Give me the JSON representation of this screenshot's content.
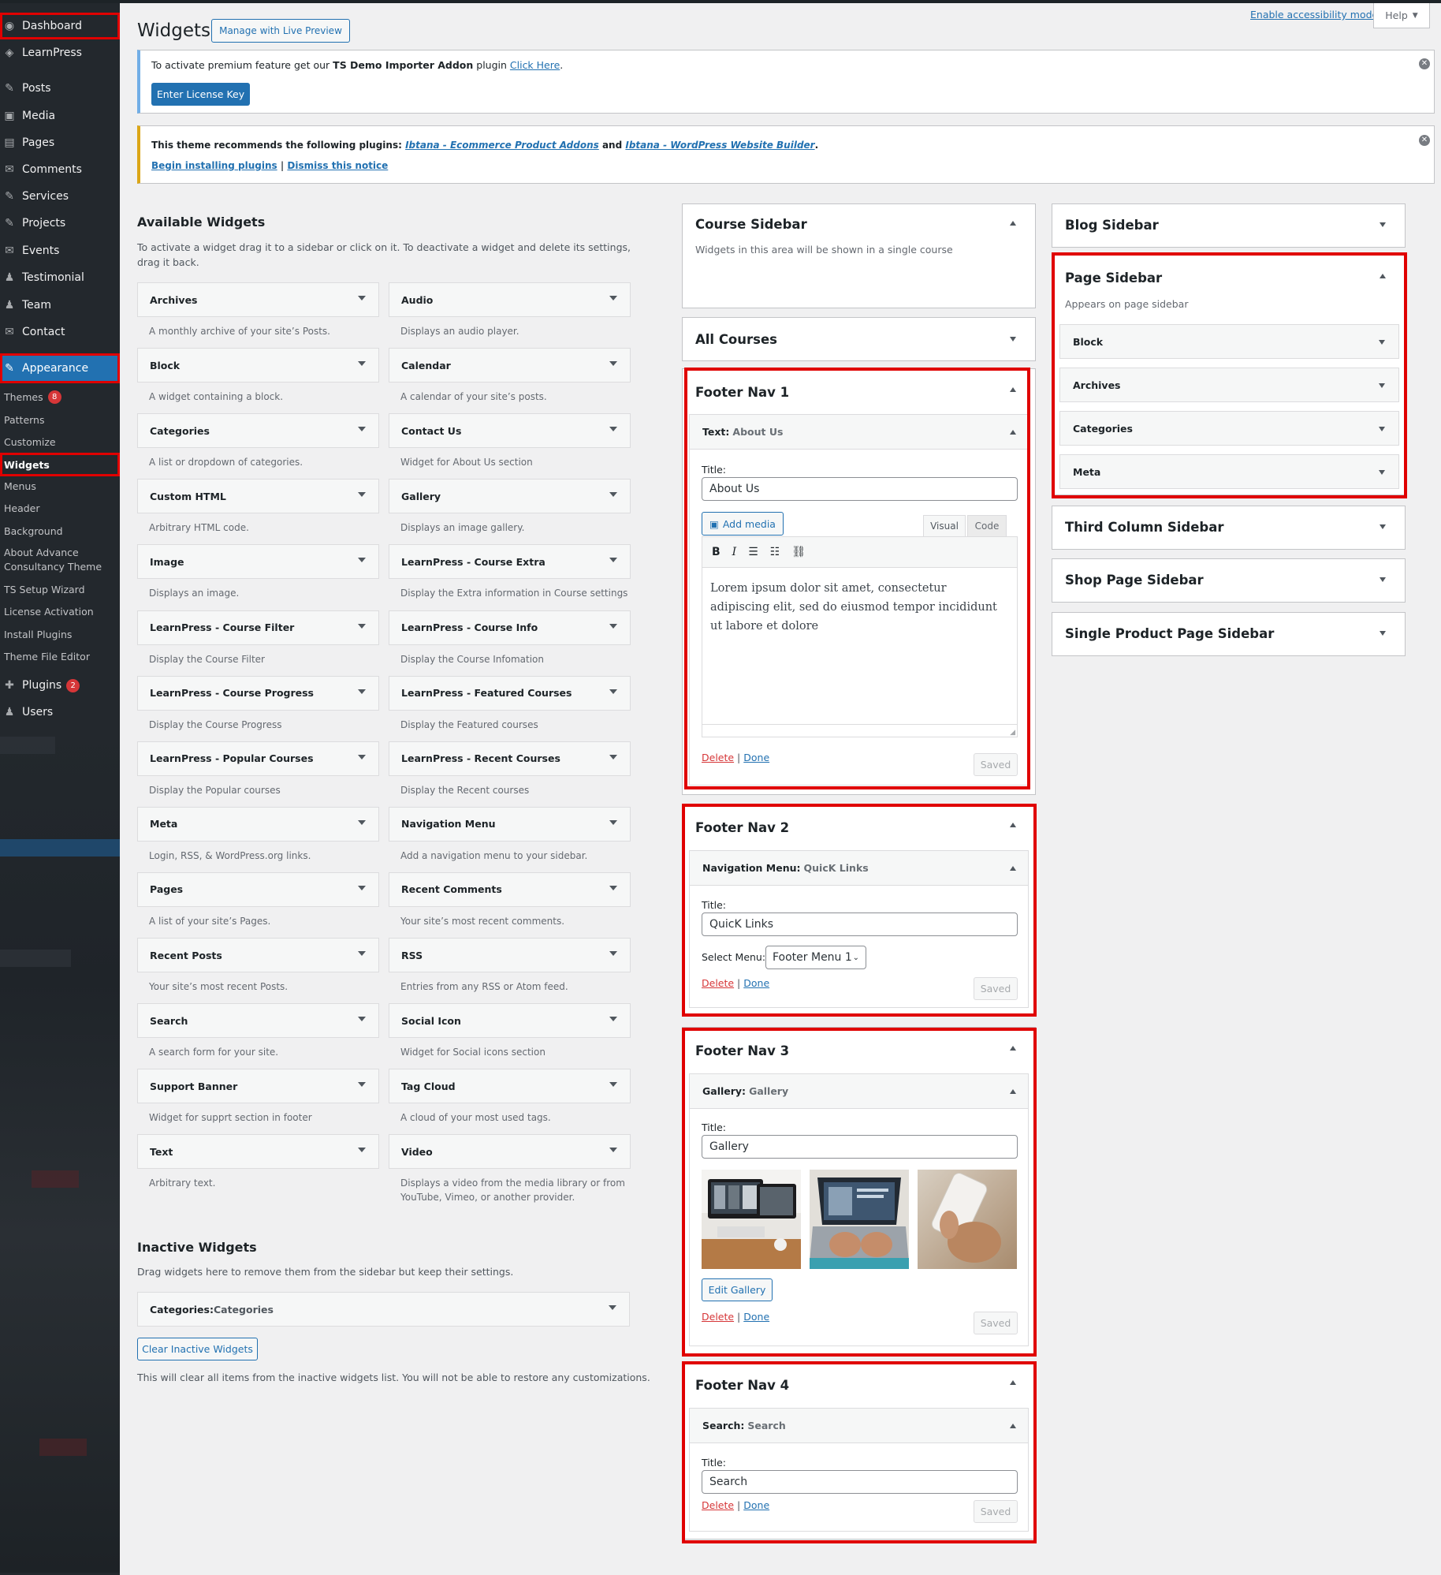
{
  "nav": {
    "items": [
      {
        "label": "Dashboard",
        "icon": "dashboard-icon",
        "glyph": "◉"
      },
      {
        "label": "LearnPress",
        "icon": "learnpress-icon",
        "glyph": "◈"
      },
      {
        "label": "Posts",
        "icon": "pin-icon",
        "glyph": "✎"
      },
      {
        "label": "Media",
        "icon": "media-icon",
        "glyph": "▣"
      },
      {
        "label": "Pages",
        "icon": "pages-icon",
        "glyph": "▤"
      },
      {
        "label": "Comments",
        "icon": "comments-icon",
        "glyph": "✉"
      },
      {
        "label": "Services",
        "icon": "services-icon",
        "glyph": "✎"
      },
      {
        "label": "Projects",
        "icon": "projects-icon",
        "glyph": "✎"
      },
      {
        "label": "Events",
        "icon": "events-icon",
        "glyph": "✉"
      },
      {
        "label": "Testimonial",
        "icon": "testimonial-icon",
        "glyph": "♟"
      },
      {
        "label": "Team",
        "icon": "team-icon",
        "glyph": "♟"
      },
      {
        "label": "Contact",
        "icon": "contact-icon",
        "glyph": "✉"
      },
      {
        "label": "Appearance",
        "icon": "appearance-icon",
        "glyph": "✎"
      },
      {
        "label": "Plugins",
        "icon": "plugins-icon",
        "glyph": "✚"
      },
      {
        "label": "Users",
        "icon": "users-icon",
        "glyph": "♟"
      }
    ],
    "appearance_sub": [
      "Themes",
      "Patterns",
      "Customize",
      "Widgets",
      "Menus",
      "Header",
      "Background",
      "About Advance Consultancy Theme",
      "TS Setup Wizard",
      "License Activation",
      "Install Plugins",
      "Theme File Editor"
    ],
    "themes_badge": "8",
    "plugins_badge": "2"
  },
  "header": {
    "title": "Widgets",
    "live_preview": "Manage with Live Preview",
    "accessibility": "Enable accessibility mode",
    "help": "Help"
  },
  "notice1": {
    "text_a": "To activate premium feature get our ",
    "text_b": "TS Demo Importer Addon",
    "text_c": " plugin ",
    "link": "Click Here",
    "text_d": ".",
    "button": "Enter License Key"
  },
  "notice2": {
    "text_a": "This theme recommends the following plugins: ",
    "plugin1": "Ibtana - Ecommerce Product Addons",
    "and": " and ",
    "plugin2": "Ibtana - WordPress Website Builder",
    "end": ".",
    "begin": "Begin installing plugins",
    "sep": " | ",
    "dismiss": "Dismiss this notice"
  },
  "available": {
    "title": "Available Widgets",
    "desc": "To activate a widget drag it to a sidebar or click on it. To deactivate a widget and delete its settings, drag it back.",
    "widgets": [
      {
        "name": "Archives",
        "desc": "A monthly archive of your site’s Posts."
      },
      {
        "name": "Audio",
        "desc": "Displays an audio player."
      },
      {
        "name": "Block",
        "desc": "A widget containing a block."
      },
      {
        "name": "Calendar",
        "desc": "A calendar of your site’s posts."
      },
      {
        "name": "Categories",
        "desc": "A list or dropdown of categories."
      },
      {
        "name": "Contact Us",
        "desc": "Widget for About Us section"
      },
      {
        "name": "Custom HTML",
        "desc": "Arbitrary HTML code."
      },
      {
        "name": "Gallery",
        "desc": "Displays an image gallery."
      },
      {
        "name": "Image",
        "desc": "Displays an image."
      },
      {
        "name": "LearnPress - Course Extra",
        "desc": "Display the Extra information in Course settings"
      },
      {
        "name": "LearnPress - Course Filter",
        "desc": "Display the Course Filter"
      },
      {
        "name": "LearnPress - Course Info",
        "desc": "Display the Course Infomation"
      },
      {
        "name": "LearnPress - Course Progress",
        "desc": "Display the Course Progress"
      },
      {
        "name": "LearnPress - Featured Courses",
        "desc": "Display the Featured courses"
      },
      {
        "name": "LearnPress - Popular Courses",
        "desc": "Display the Popular courses"
      },
      {
        "name": "LearnPress - Recent Courses",
        "desc": "Display the Recent courses"
      },
      {
        "name": "Meta",
        "desc": "Login, RSS, & WordPress.org links."
      },
      {
        "name": "Navigation Menu",
        "desc": "Add a navigation menu to your sidebar."
      },
      {
        "name": "Pages",
        "desc": "A list of your site’s Pages."
      },
      {
        "name": "Recent Comments",
        "desc": "Your site’s most recent comments."
      },
      {
        "name": "Recent Posts",
        "desc": "Your site’s most recent Posts."
      },
      {
        "name": "RSS",
        "desc": "Entries from any RSS or Atom feed."
      },
      {
        "name": "Search",
        "desc": "A search form for your site."
      },
      {
        "name": "Social Icon",
        "desc": "Widget for Social icons section"
      },
      {
        "name": "Support Banner",
        "desc": "Widget for supprt section in footer"
      },
      {
        "name": "Tag Cloud",
        "desc": "A cloud of your most used tags."
      },
      {
        "name": "Text",
        "desc": "Arbitrary text."
      },
      {
        "name": "Video",
        "desc": "Displays a video from the media library or from YouTube, Vimeo, or another provider."
      }
    ]
  },
  "inactive": {
    "title": "Inactive Widgets",
    "desc": "Drag widgets here to remove them from the sidebar but keep their settings.",
    "widget_type": "Categories:",
    "widget_title": " Categories",
    "clear": "Clear Inactive Widgets",
    "note": "This will clear all items from the inactive widgets list. You will not be able to restore any customizations."
  },
  "course_sidebar": {
    "title": "Course Sidebar",
    "desc": "Widgets in this area will be shown in a single course"
  },
  "all_courses": {
    "title": "All Courses"
  },
  "footer1": {
    "title": "Footer Nav 1",
    "widget_type": "Text:",
    "widget_title": "About Us",
    "title_label": "Title:",
    "title_value": "About Us",
    "add_media": "Add media",
    "tab_visual": "Visual",
    "tab_code": "Code",
    "content": "Lorem ipsum dolor sit amet, consectetur adipiscing elit, sed do eiusmod tempor incididunt ut labore et dolore"
  },
  "footer2": {
    "title": "Footer Nav 2",
    "widget_type": "Navigation Menu:",
    "widget_title": "QuicK Links",
    "title_label": "Title:",
    "title_value": "QuicK Links",
    "select_label": "Select Menu:",
    "select_value": "Footer Menu 1"
  },
  "footer3": {
    "title": "Footer Nav 3",
    "widget_type": "Gallery:",
    "widget_title": "Gallery",
    "title_label": "Title:",
    "title_value": "Gallery",
    "edit": "Edit Gallery"
  },
  "footer4": {
    "title": "Footer Nav 4",
    "widget_type": "Search:",
    "widget_title": "Search",
    "title_label": "Title:",
    "title_value": "Search"
  },
  "common": {
    "delete": "Delete",
    "sep": " | ",
    "done": "Done",
    "saved": "Saved"
  },
  "right": {
    "blog": "Blog Sidebar",
    "page": "Page Sidebar",
    "page_desc": "Appears on page sidebar",
    "page_widgets": [
      "Block",
      "Archives",
      "Categories",
      "Meta"
    ],
    "third": "Third Column Sidebar",
    "shop": "Shop Page Sidebar",
    "single": "Single Product Page Sidebar"
  },
  "colors": {
    "accent": "#2271b1",
    "highlight": "#e00000",
    "sidebar_bg": "#23282d"
  }
}
